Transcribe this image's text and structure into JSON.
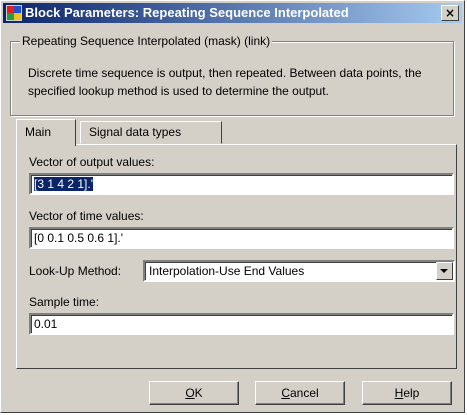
{
  "window": {
    "title": "Block Parameters: Repeating Sequence Interpolated",
    "close_glyph": "×"
  },
  "group": {
    "legend": "Repeating Sequence Interpolated (mask) (link)",
    "description": "Discrete time sequence is output, then repeated.  Between data points, the specified lookup method is used to determine the output."
  },
  "tabs": [
    {
      "label": "Main",
      "active": true
    },
    {
      "label": "Signal data types",
      "active": false
    }
  ],
  "params": {
    "output_values_label": "Vector of output values:",
    "output_values_value": "[3 1 4 2 1].'",
    "time_values_label": "Vector of time values:",
    "time_values_value": "[0 0.1 0.5 0.6 1].'",
    "lookup_label": "Look-Up Method:",
    "lookup_value": "Interpolation-Use End Values",
    "sample_time_label": "Sample time:",
    "sample_time_value": "0.01"
  },
  "buttons": {
    "ok_mnemonic": "O",
    "ok_rest": "K",
    "cancel_mnemonic": "C",
    "cancel_rest": "ancel",
    "help_mnemonic": "H",
    "help_rest": "elp"
  },
  "icons": {
    "app": "simulink-block-icon",
    "close": "close-icon",
    "dropdown": "chevron-down-icon"
  }
}
